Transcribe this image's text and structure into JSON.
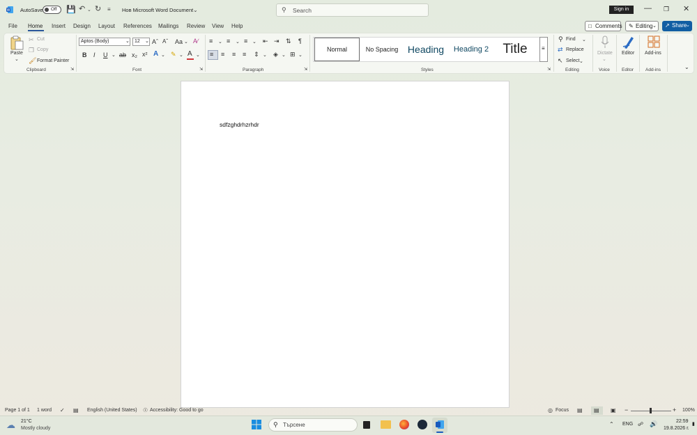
{
  "titlebar": {
    "autosave_label": "AutoSave",
    "autosave_state": "Off",
    "document_title": "Нов Microsoft Word Document",
    "search_placeholder": "Search",
    "sign_in": "Sign in"
  },
  "tabs": [
    "File",
    "Home",
    "Insert",
    "Design",
    "Layout",
    "References",
    "Mailings",
    "Review",
    "View",
    "Help"
  ],
  "active_tab": "Home",
  "header_buttons": {
    "comments": "Comments",
    "editing": "Editing",
    "share": "Share"
  },
  "ribbon": {
    "clipboard": {
      "paste": "Paste",
      "cut": "Cut",
      "copy": "Copy",
      "format_painter": "Format Painter",
      "label": "Clipboard"
    },
    "font": {
      "name": "Aptos (Body)",
      "size": "12",
      "label": "Font"
    },
    "paragraph": {
      "label": "Paragraph"
    },
    "styles": {
      "items": [
        "Normal",
        "No Spacing",
        "Heading",
        "Heading 2",
        "Title"
      ],
      "label": "Styles"
    },
    "editing": {
      "find": "Find",
      "replace": "Replace",
      "select": "Select",
      "label": "Editing"
    },
    "voice": {
      "dictate": "Dictate",
      "label": "Voice"
    },
    "editor": {
      "button": "Editor",
      "label": "Editor"
    },
    "addins": {
      "button": "Add-ins",
      "label": "Add-ins"
    }
  },
  "document": {
    "body_text": "sdfzghdrhzrhdr"
  },
  "statusbar": {
    "page": "Page 1 of 1",
    "words": "1 word",
    "language": "English (United States)",
    "accessibility": "Accessibility: Good to go",
    "focus": "Focus",
    "zoom": "100%"
  },
  "taskbar": {
    "weather_temp": "21°C",
    "weather_desc": "Mostly cloudy",
    "search_placeholder": "Търсене",
    "lang": "ENG",
    "time": "22:59",
    "date": "19.8.2026 г."
  },
  "colors": {
    "accent": "#2b579a",
    "share": "#115ea3",
    "word_blue": "#185abd"
  }
}
